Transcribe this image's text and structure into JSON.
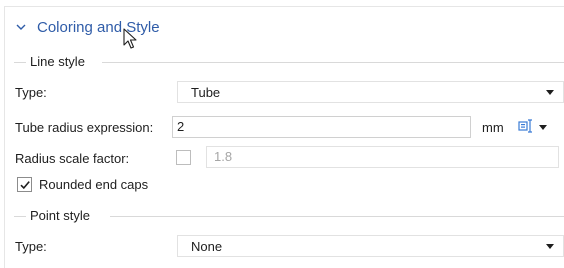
{
  "section": {
    "title": "Coloring and Style",
    "expanded": true
  },
  "line_style": {
    "group_label": "Line style",
    "type_label": "Type:",
    "type_value": "Tube",
    "tube_radius_label": "Tube radius expression:",
    "tube_radius_value": "2",
    "tube_radius_unit": "mm",
    "radius_scale_label": "Radius scale factor:",
    "radius_scale_checked": false,
    "radius_scale_value": "1.8",
    "rounded_caps_label": "Rounded end caps",
    "rounded_caps_checked": true
  },
  "point_style": {
    "group_label": "Point style",
    "type_label": "Type:",
    "type_value": "None"
  },
  "icons": {
    "expand": "chevron-down-icon",
    "insert_expression": "insert-expression-icon",
    "pointer": "mouse-pointer-icon",
    "check": "checkmark-icon"
  },
  "colors": {
    "accent": "#2f5ca8",
    "tool_icon": "#3a7bd5"
  }
}
